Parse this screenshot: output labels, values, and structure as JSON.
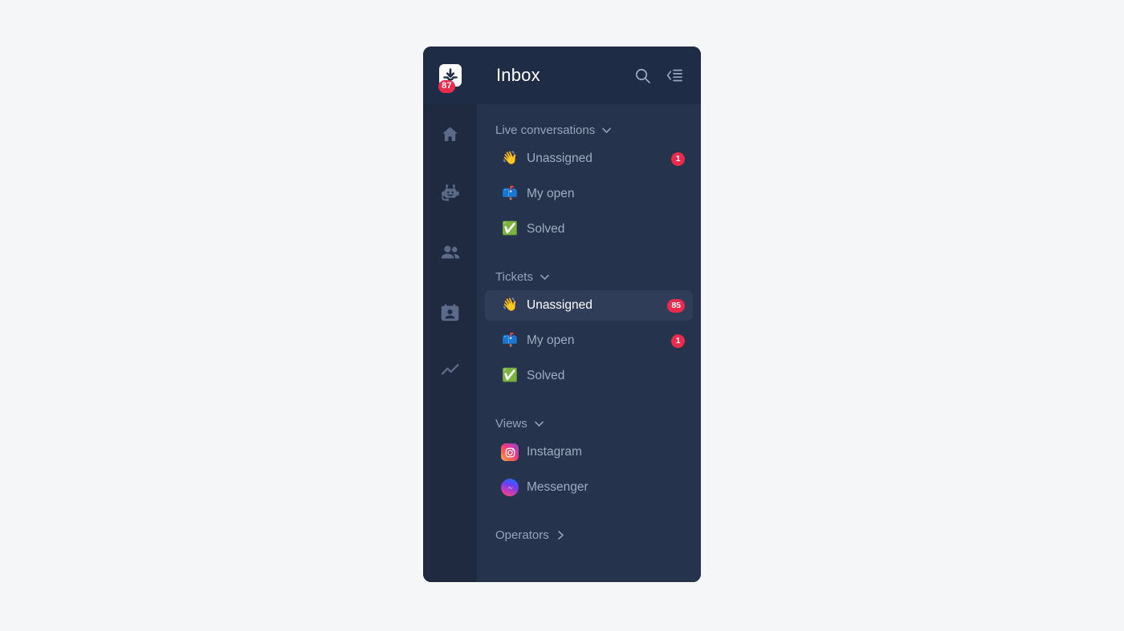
{
  "page": {
    "background_color": "#f5f6f8"
  },
  "panel": {
    "background_color": "#26334d",
    "rail_color": "#1f2a40",
    "header_color": "#1f2c45",
    "selected_row_color": "#2f3d59",
    "badge_color": "#ea2b4c"
  },
  "header": {
    "title": "Inbox",
    "logo": {
      "icon": "inbox-download-icon",
      "badge_count": "87"
    },
    "actions": [
      {
        "icon": "search-icon",
        "name": "search-button"
      },
      {
        "icon": "collapse-sidebar-icon",
        "name": "collapse-sidebar-button"
      }
    ]
  },
  "rail": {
    "items": [
      {
        "icon": "home-icon",
        "name": "rail-item-home"
      },
      {
        "icon": "chatbot-icon",
        "name": "rail-item-bots"
      },
      {
        "icon": "people-icon",
        "name": "rail-item-contacts"
      },
      {
        "icon": "contact-card-icon",
        "name": "rail-item-profiles"
      },
      {
        "icon": "analytics-trend-icon",
        "name": "rail-item-reports"
      }
    ]
  },
  "sections": [
    {
      "title": "Live conversations",
      "chevron": "chevron-down-icon",
      "expanded": true,
      "items": [
        {
          "emoji": "👋",
          "emoji_name": "waving-hand-emoji",
          "label": "Unassigned",
          "badge": "1",
          "selected": false
        },
        {
          "emoji": "📫",
          "emoji_name": "mailbox-emoji",
          "label": "My open",
          "badge": "",
          "selected": false
        },
        {
          "emoji": "✅",
          "emoji_name": "check-mark-emoji",
          "label": "Solved",
          "badge": "",
          "selected": false
        }
      ]
    },
    {
      "title": "Tickets",
      "chevron": "chevron-down-icon",
      "expanded": true,
      "items": [
        {
          "emoji": "👋",
          "emoji_name": "waving-hand-emoji",
          "label": "Unassigned",
          "badge": "85",
          "selected": true
        },
        {
          "emoji": "📫",
          "emoji_name": "mailbox-emoji",
          "label": "My open",
          "badge": "1",
          "selected": false
        },
        {
          "emoji": "✅",
          "emoji_name": "check-mark-emoji",
          "label": "Solved",
          "badge": "",
          "selected": false
        }
      ]
    },
    {
      "title": "Views",
      "chevron": "chevron-down-icon",
      "expanded": true,
      "items": [
        {
          "brand": "instagram",
          "emoji_name": "instagram-icon",
          "label": "Instagram",
          "badge": "",
          "selected": false
        },
        {
          "brand": "messenger",
          "emoji_name": "messenger-icon",
          "label": "Messenger",
          "badge": "",
          "selected": false
        }
      ]
    },
    {
      "title": "Operators",
      "chevron": "chevron-right-icon",
      "expanded": false,
      "items": []
    }
  ]
}
